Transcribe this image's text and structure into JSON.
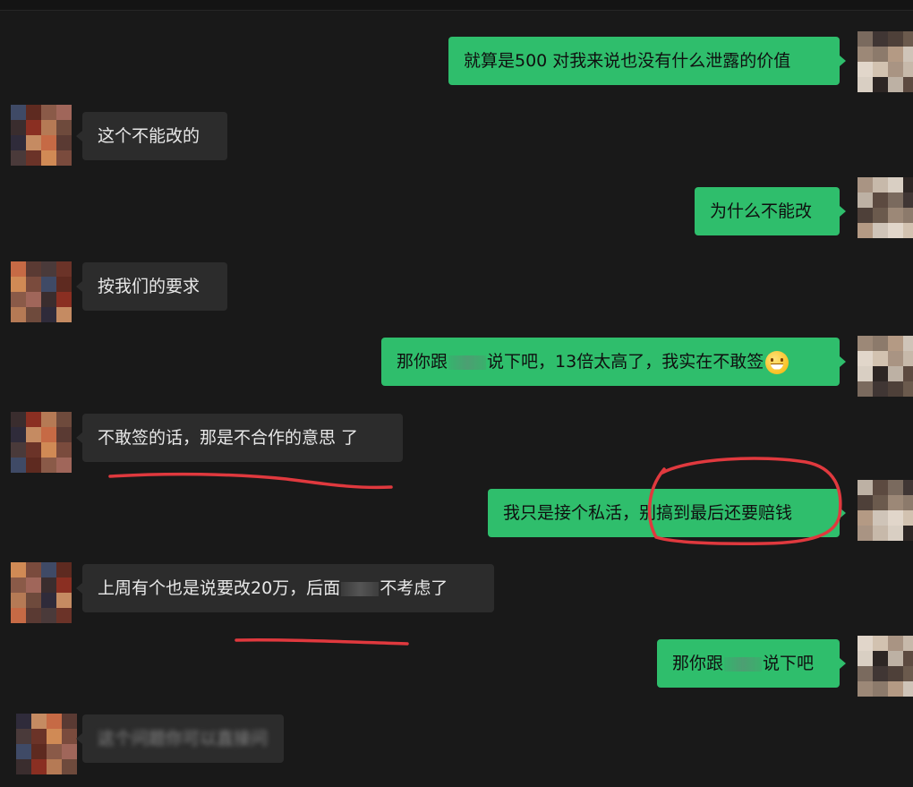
{
  "messages": [
    {
      "side": "out",
      "text": "就算是500 对我来说也没有什么泄露的价值"
    },
    {
      "side": "in",
      "text": "这个不能改的"
    },
    {
      "side": "out",
      "text": "为什么不能改"
    },
    {
      "side": "in",
      "text": "按我们的要求"
    },
    {
      "side": "out",
      "text_before": "那你跟",
      "text_after": "说下吧，13倍太高了，我实在不敢签",
      "emoji": "grinning-face-emoji"
    },
    {
      "side": "in",
      "text": "不敢签的话，那是不合作的意思 了"
    },
    {
      "side": "out",
      "text": "我只是接个私活，别搞到最后还要赔钱"
    },
    {
      "side": "in",
      "text_before": "上周有个也是说要改20万，后面",
      "text_after": "不考虑了"
    },
    {
      "side": "out",
      "text_before": "那你跟",
      "text_after": "说下吧"
    },
    {
      "side": "in",
      "text": "这个问题你可以直接问"
    }
  ],
  "colors": {
    "background": "#191919",
    "incoming_bubble": "#2c2c2c",
    "outgoing_bubble": "#2fbe6c",
    "annotation_red": "#e0393e"
  }
}
